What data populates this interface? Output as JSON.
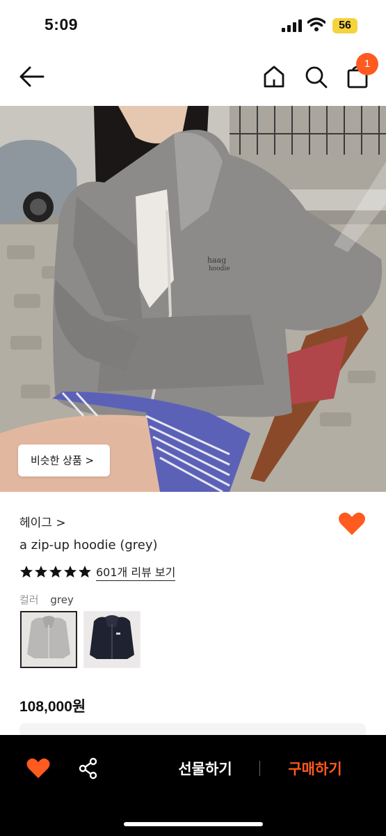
{
  "status_bar": {
    "time": "5:09",
    "battery": "56",
    "icons": [
      "signal-icon",
      "wifi-icon",
      "battery-icon"
    ]
  },
  "nav": {
    "icons": [
      "back-arrow-icon",
      "home-icon",
      "search-icon",
      "shopping-bag-icon"
    ],
    "cart_count": "1"
  },
  "hero": {
    "similar_button_label": "비슷한 상품 >"
  },
  "product": {
    "brand": "헤이그 >",
    "name": "a zip-up hoodie (grey)",
    "rating_stars": 5,
    "review_link": "601개 리뷰 보기",
    "color_label": "컬러",
    "color_value": "grey",
    "swatches": [
      "grey",
      "navy"
    ],
    "price": "108,000원"
  },
  "bottom_bar": {
    "gift_label": "선물하기",
    "buy_label": "구매하기"
  },
  "colors": {
    "accent": "#ff5a1f",
    "bottom_bar_bg": "#000000",
    "battery": "#f5d33c"
  }
}
